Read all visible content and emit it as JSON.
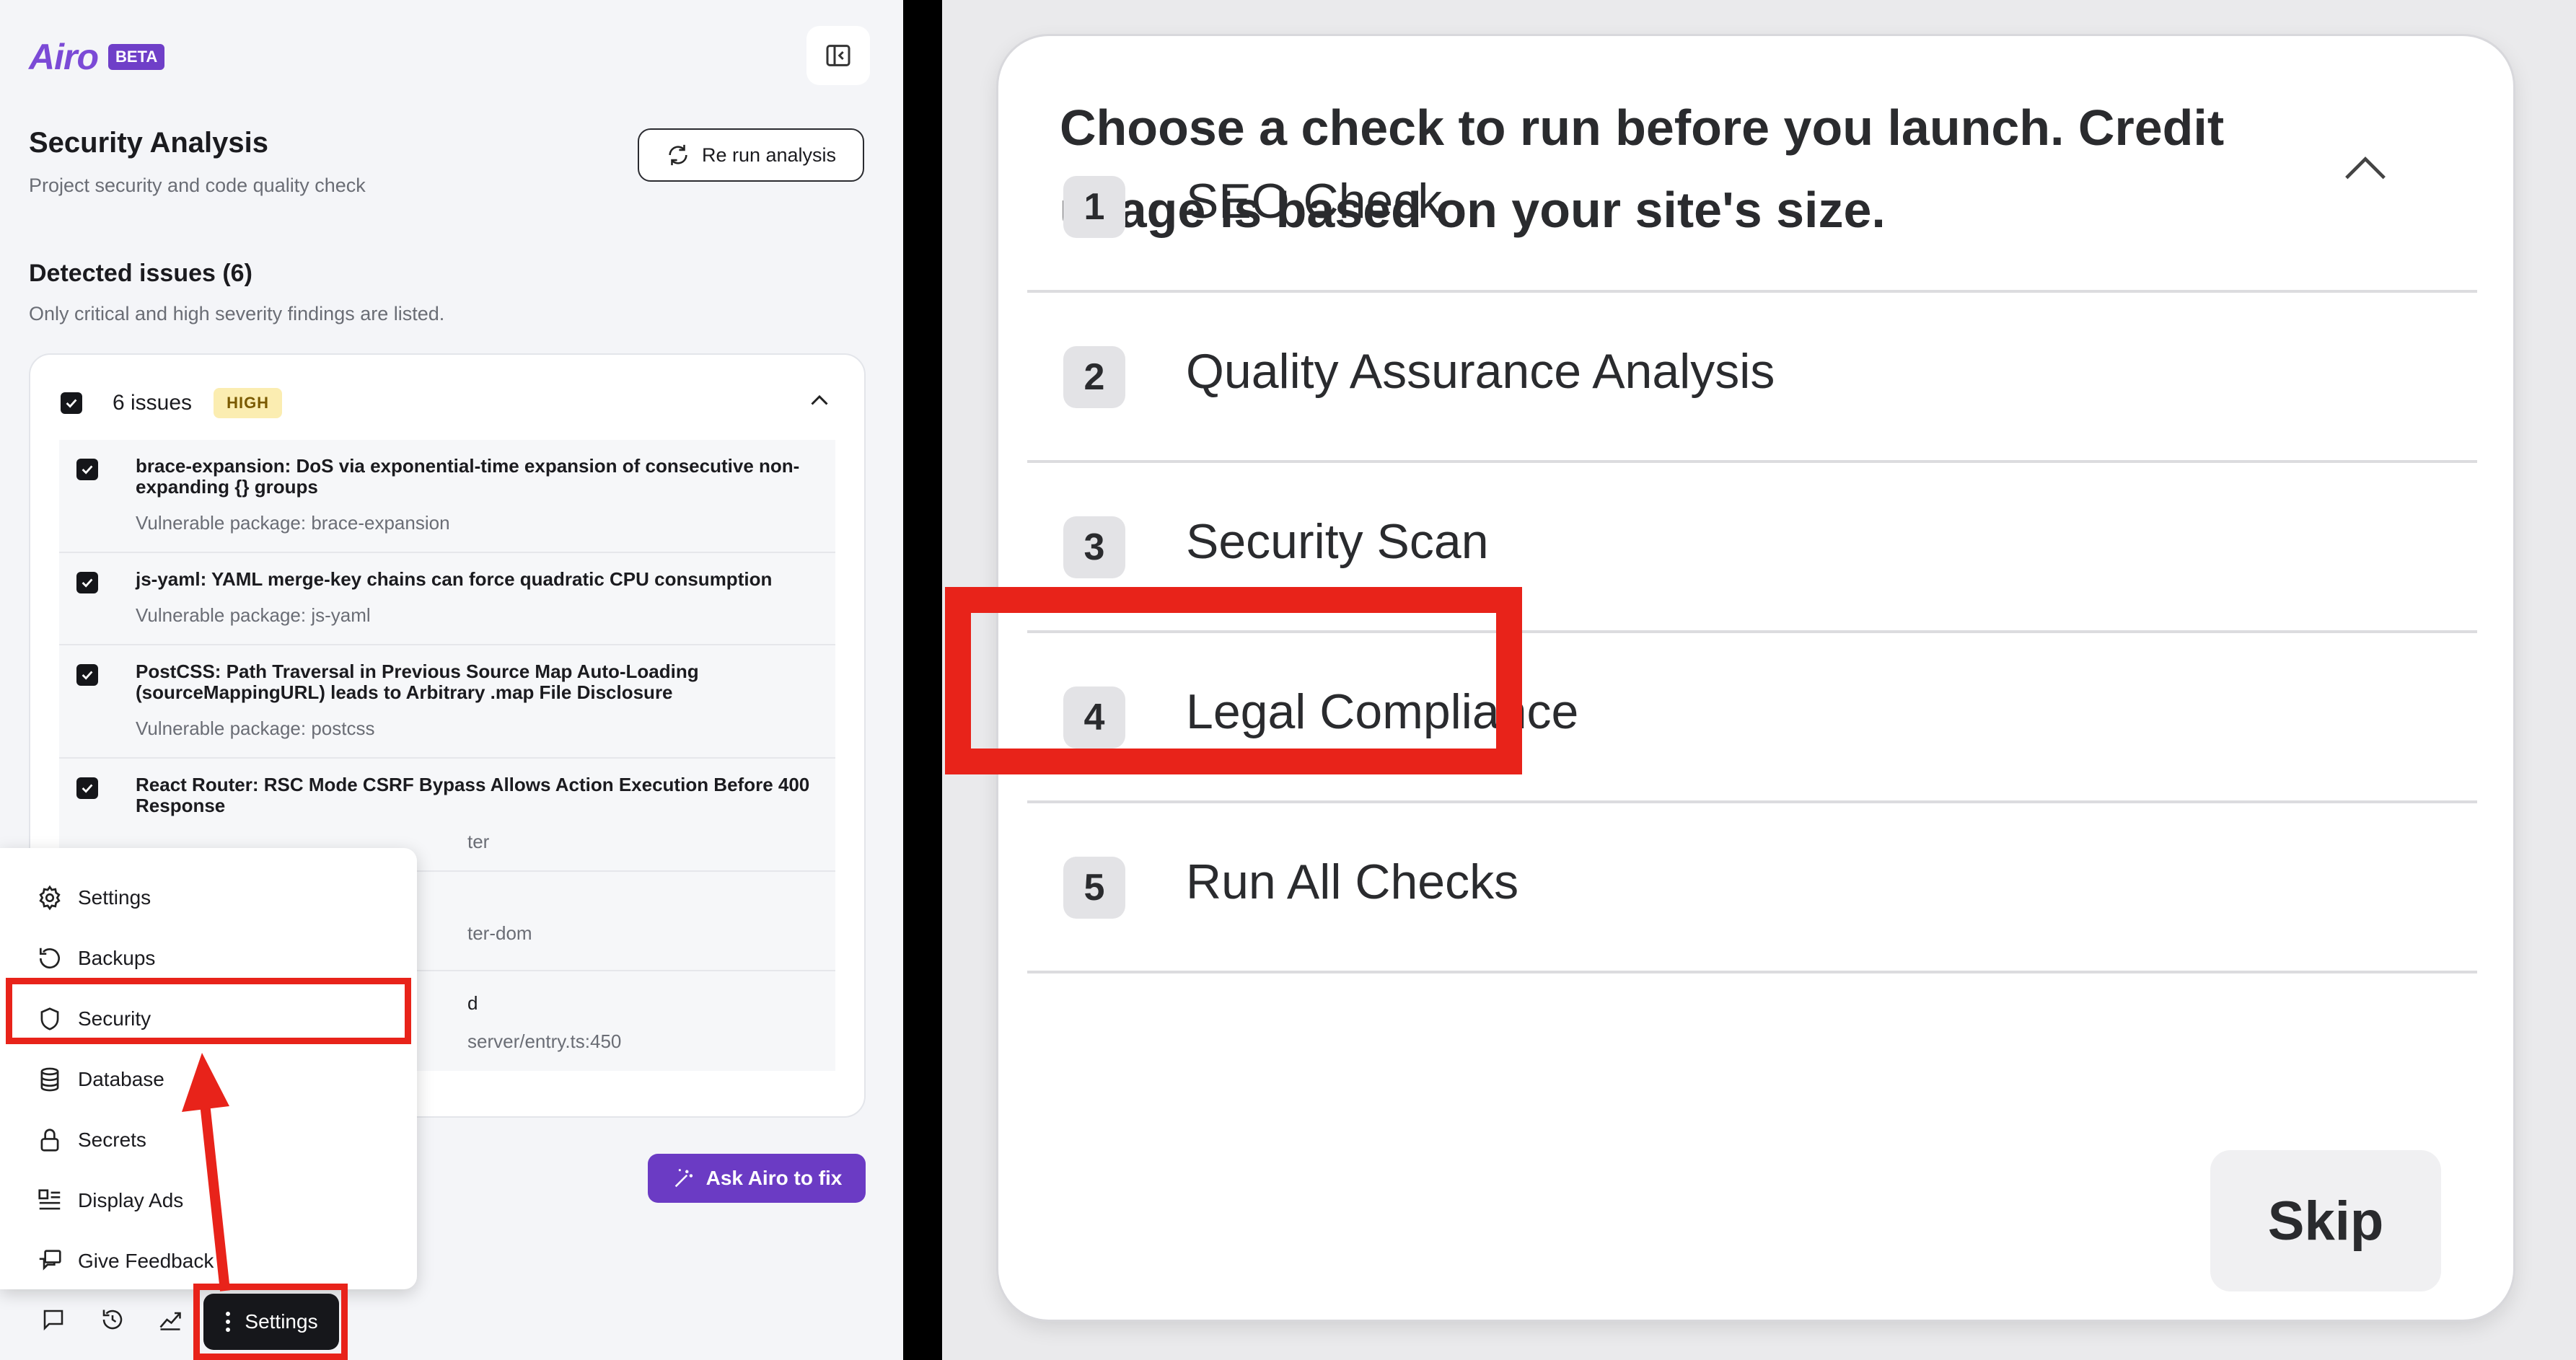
{
  "brand": {
    "name": "Airo",
    "badge": "BETA"
  },
  "security": {
    "title": "Security Analysis",
    "subtitle": "Project security and code quality check",
    "rerun_label": "Re run analysis"
  },
  "detected": {
    "title": "Detected issues (6)",
    "subtitle": "Only critical and high severity findings are listed.",
    "group_count": "6 issues",
    "severity": "HIGH",
    "issues": [
      {
        "title": "brace-expansion: DoS via exponential-time expansion of consecutive non-expanding {} groups",
        "pkg": "Vulnerable package: brace-expansion"
      },
      {
        "title": "js-yaml: YAML merge-key chains can force quadratic CPU consumption",
        "pkg": "Vulnerable package: js-yaml"
      },
      {
        "title": "PostCSS: Path Traversal in Previous Source Map Auto-Loading (sourceMappingURL) leads to Arbitrary .map File Disclosure",
        "pkg": "Vulnerable package: postcss"
      },
      {
        "title": "React Router: RSC Mode CSRF Bypass Allows Action Execution Before 400 Response",
        "pkg": "ter"
      },
      {
        "title": "",
        "pkg": "ter-dom"
      },
      {
        "title": "d",
        "pkg": "server/entry.ts:450"
      }
    ]
  },
  "ask_label": "Ask Airo to fix",
  "menu": {
    "items": [
      "Settings",
      "Backups",
      "Security",
      "Database",
      "Secrets",
      "Display Ads",
      "Give Feedback"
    ]
  },
  "bottom_settings_label": "Settings",
  "dialog": {
    "heading": "Choose a check to run before you launch. Credit usage is based on your site's size.",
    "options": [
      {
        "num": "1",
        "label": "SEO Check"
      },
      {
        "num": "2",
        "label": "Quality Assurance Analysis"
      },
      {
        "num": "3",
        "label": "Security Scan"
      },
      {
        "num": "4",
        "label": "Legal Compliance"
      },
      {
        "num": "5",
        "label": "Run All Checks"
      }
    ],
    "skip_label": "Skip"
  },
  "colors": {
    "accent": "#6b3bc4",
    "highlight": "#e8231a",
    "badge_bg": "#fbedb1"
  }
}
